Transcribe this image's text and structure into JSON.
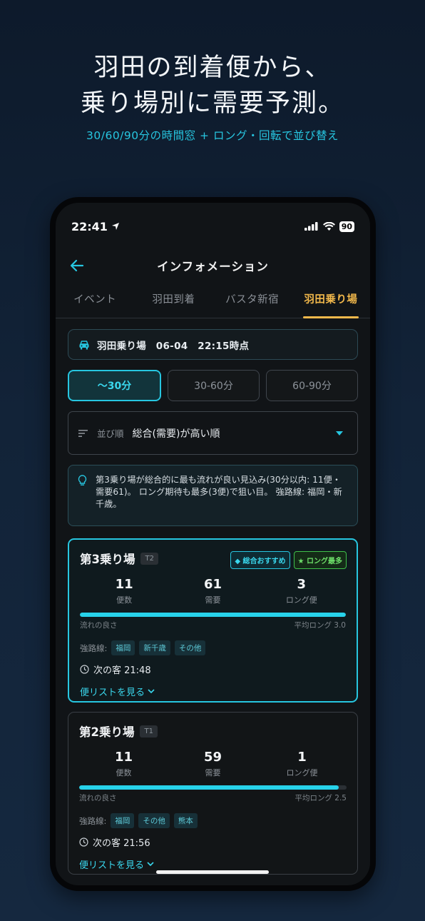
{
  "hero": {
    "line1": "羽田の到着便から、",
    "line2": "乗り場別に需要予測。",
    "sub": "30/60/90分の時間窓 + ロング・回転で並び替え"
  },
  "status": {
    "time": "22:41",
    "battery": "90"
  },
  "nav": {
    "title": "インフォメーション"
  },
  "tabs": [
    {
      "label": "イベント"
    },
    {
      "label": "羽田到着"
    },
    {
      "label": "バスタ新宿"
    },
    {
      "label": "羽田乗り場"
    }
  ],
  "header": {
    "text": "羽田乗り場　06-04　22:15時点"
  },
  "segments": [
    {
      "label": "〜30分"
    },
    {
      "label": "30-60分"
    },
    {
      "label": "60-90分"
    }
  ],
  "sort": {
    "label": "並び順",
    "value": "総合(需要)が高い順"
  },
  "tip": {
    "text": "第3乗り場が総合的に最も流れが良い見込み(30分以内: 11便・需要61)。 ロング期待も最多(3便)で狙い目。 強路線: 福岡・新千歳。"
  },
  "cards": [
    {
      "name": "第3乗り場",
      "terminal": "T2",
      "badge_total": "総合おすすめ",
      "badge_long": "ロング最多",
      "flights": "11",
      "flights_lbl": "便数",
      "demand": "61",
      "demand_lbl": "需要",
      "long": "3",
      "long_lbl": "ロング便",
      "flow_lbl": "流れの良さ",
      "flow_fraction": 1.0,
      "avg_long": "平均ロング 3.0",
      "routes_lbl": "強路線:",
      "routes": [
        "福岡",
        "新千歳",
        "その他"
      ],
      "next": "次の客 21:48",
      "link": "便リストを見る"
    },
    {
      "name": "第2乗り場",
      "terminal": "T1",
      "flights": "11",
      "flights_lbl": "便数",
      "demand": "59",
      "demand_lbl": "需要",
      "long": "1",
      "long_lbl": "ロング便",
      "flow_lbl": "流れの良さ",
      "flow_fraction": 0.97,
      "avg_long": "平均ロング 2.5",
      "routes_lbl": "強路線:",
      "routes": [
        "福岡",
        "その他",
        "熊本"
      ],
      "next": "次の客 21:56",
      "link": "便リストを見る"
    }
  ]
}
